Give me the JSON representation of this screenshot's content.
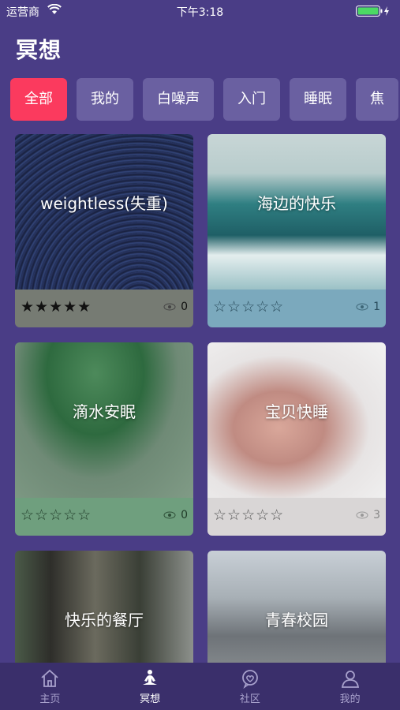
{
  "status_bar": {
    "carrier": "运营商",
    "time": "下午3:18"
  },
  "header": {
    "title": "冥想"
  },
  "tabs": [
    {
      "label": "全部",
      "active": true
    },
    {
      "label": "我的"
    },
    {
      "label": "白噪声"
    },
    {
      "label": "入门"
    },
    {
      "label": "睡眠"
    },
    {
      "label": "焦"
    }
  ],
  "cards": [
    {
      "name": "weightless(失重)",
      "rating_text": "★★★★★",
      "views": "0"
    },
    {
      "name": "海边的快乐",
      "rating_text": "☆☆☆☆☆",
      "views": "1"
    },
    {
      "name": "滴水安眠",
      "rating_text": "☆☆☆☆☆",
      "views": "0"
    },
    {
      "name": "宝贝快睡",
      "rating_text": "☆☆☆☆☆",
      "views": "3"
    },
    {
      "name": "快乐的餐厅",
      "rating_text": "",
      "views": ""
    },
    {
      "name": "青春校园",
      "rating_text": "",
      "views": ""
    }
  ],
  "tabbar": [
    {
      "label": "主页",
      "icon": "home-icon"
    },
    {
      "label": "冥想",
      "icon": "meditation-icon",
      "active": true
    },
    {
      "label": "社区",
      "icon": "community-icon"
    },
    {
      "label": "我的",
      "icon": "profile-icon"
    }
  ],
  "colors": {
    "background": "#4a3d86",
    "accent": "#fb3a5e",
    "tab": "#6a60a1",
    "tabbar": "#3a2f6b"
  }
}
